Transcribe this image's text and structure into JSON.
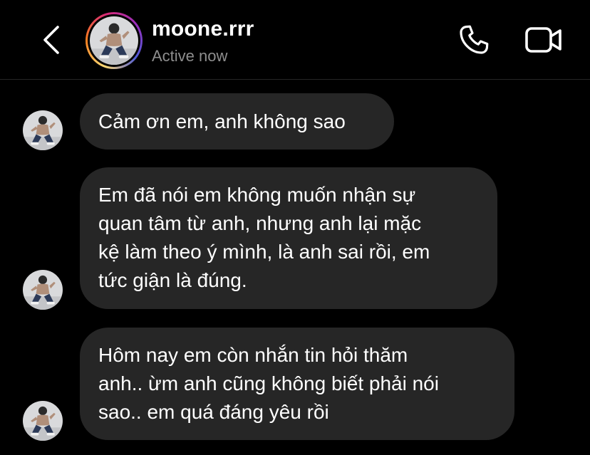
{
  "header": {
    "username": "moone.rrr",
    "status": "Active now"
  },
  "icons": {
    "back": "chevron-left-icon",
    "call": "phone-icon",
    "video": "video-camera-icon"
  },
  "colors": {
    "background": "#000000",
    "bubble": "#262626",
    "status_text": "#8e8e8e",
    "story_ring": [
      "#feda75",
      "#fa7e1e",
      "#d62976",
      "#962fbf",
      "#4f5bd5"
    ]
  },
  "messages": [
    {
      "lines": [
        "Cảm ơn em, anh không sao"
      ]
    },
    {
      "lines": [
        "Em đã nói em không muốn nhận sự",
        "quan tâm từ anh, nhưng anh lại mặc",
        "kệ làm theo ý mình, là anh sai rồi, em",
        "tức giận là đúng."
      ]
    },
    {
      "lines": [
        "Hôm nay em còn nhắn tin hỏi thăm",
        "anh.. ừm anh cũng không biết phải nói",
        "sao.. em quá đáng yêu rồi"
      ]
    }
  ]
}
